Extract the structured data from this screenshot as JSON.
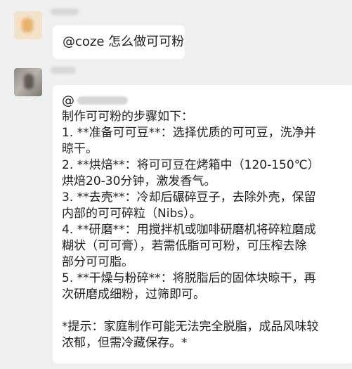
{
  "message_1": {
    "text": "@coze 怎么做可可粉"
  },
  "message_2": {
    "mention_prefix": "@",
    "lines": {
      "intro": "制作可可粉的步骤如下：",
      "step1_a": "1. **准备可可豆**：选择优质的可可豆，洗净并",
      "step1_b": "晾干。",
      "step2_a": "2. **烘焙**：将可可豆在烤箱中（120-150℃）",
      "step2_b": "烘焙20-30分钟，激发香气。",
      "step3_a": "3. **去壳**：冷却后碾碎豆子，去除外壳，保留",
      "step3_b": "内部的可可碎粒（Nibs）。",
      "step4_a": "4. **研磨**：用搅拌机或咖啡研磨机将碎粒磨成",
      "step4_b": "糊状（可可膏），若需低脂可可粉，可压榨去除",
      "step4_c": "部分可可脂。",
      "step5_a": "5. **干燥与粉碎**：将脱脂后的固体块晾干，再",
      "step5_b": "次研磨成细粉，过筛即可。",
      "tip_a": "*提示：家庭制作可能无法完全脱脂，成品风味较",
      "tip_b": "浓郁，但需冷藏保存。*"
    }
  },
  "colors": {
    "background": "#efefef",
    "bubble": "#ffffff",
    "text": "#1f1f1f"
  }
}
